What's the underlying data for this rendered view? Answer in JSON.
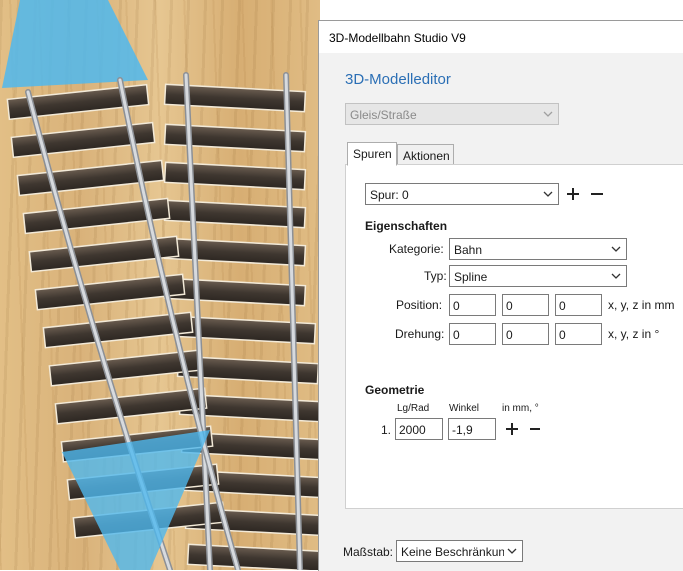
{
  "window": {
    "title": "3D-Modellbahn Studio V9"
  },
  "editor": {
    "title": "3D-Modelleditor",
    "type_combo": {
      "value": "Gleis/Straße"
    },
    "tabs": [
      {
        "label": "Spuren"
      },
      {
        "label": "Aktionen"
      }
    ],
    "track_combo": {
      "value": "Spur: 0"
    },
    "properties": {
      "heading": "Eigenschaften",
      "category": {
        "label": "Kategorie:",
        "value": "Bahn"
      },
      "type": {
        "label": "Typ:",
        "value": "Spline"
      },
      "position": {
        "label": "Position:",
        "values": [
          "0",
          "0",
          "0"
        ],
        "unit": "x, y, z in mm"
      },
      "rotation": {
        "label": "Drehung:",
        "values": [
          "0",
          "0",
          "0"
        ],
        "unit": "x, y, z in °"
      }
    },
    "geometry": {
      "heading": "Geometrie",
      "col_length": "Lg/Rad",
      "col_angle": "Winkel",
      "col_unit": "in mm, °",
      "rows": [
        {
          "index": "1.",
          "length": "2000",
          "angle": "-1,9"
        }
      ]
    }
  },
  "footer": {
    "scale_label": "Maßstab:",
    "scale_value": "Keine Beschränkung"
  },
  "colors": {
    "accent": "#2b6fb5",
    "marker": "#4fb8ee",
    "rail": "#c9ccd0",
    "sleeper": "#4a4038"
  },
  "icons": {
    "add": "plus-icon",
    "remove": "minus-icon",
    "dropdown": "chevron-down-icon",
    "start_marker": "cyan-triangle-marker",
    "end_marker": "cyan-triangle-marker"
  }
}
